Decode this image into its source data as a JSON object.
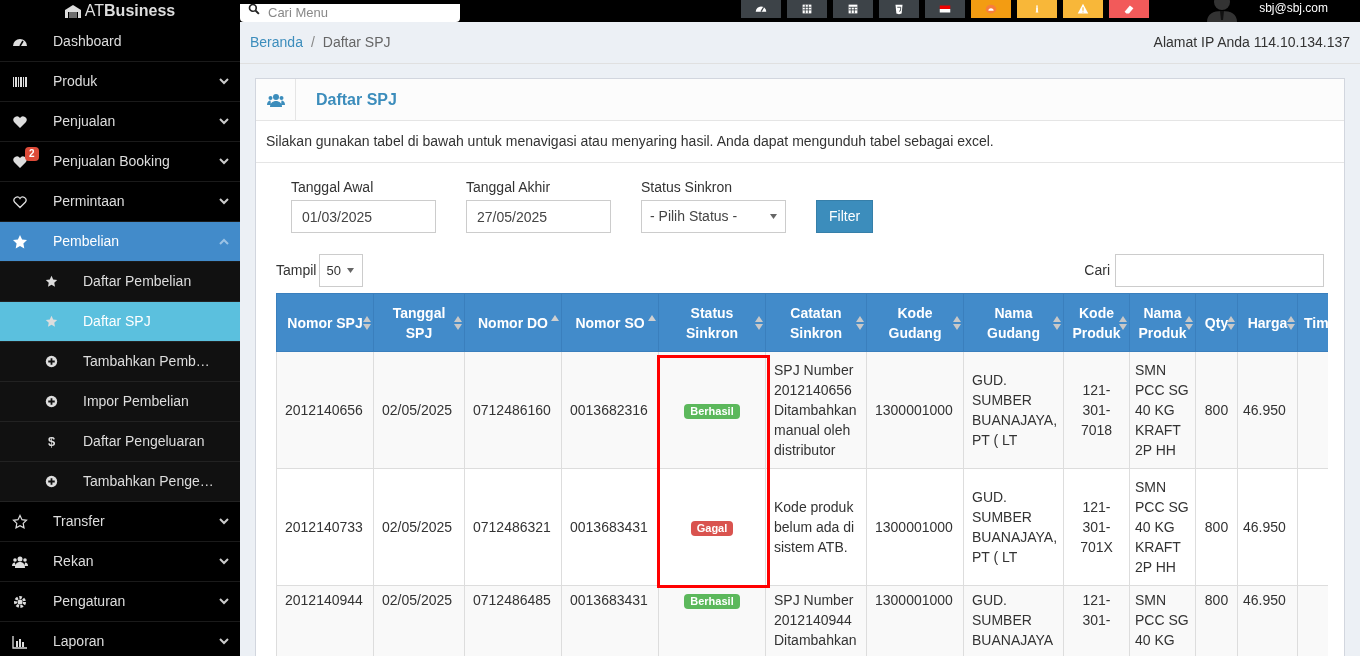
{
  "header": {
    "logo": {
      "light": "AT",
      "bold": "Business"
    },
    "search": {
      "placeholder": "Cari Menu"
    },
    "user_email": "sbj@sbj.com"
  },
  "sidebar": {
    "items": [
      {
        "label": "Dashboard",
        "has_submenu": false,
        "expanded": false,
        "selected": false
      },
      {
        "label": "Produk",
        "has_submenu": true,
        "expanded": false,
        "selected": false
      },
      {
        "label": "Penjualan",
        "has_submenu": true,
        "expanded": false,
        "selected": false
      },
      {
        "label": "Penjualan Booking",
        "badge": "2",
        "has_submenu": true,
        "expanded": false,
        "selected": false
      },
      {
        "label": "Permintaan",
        "has_submenu": true,
        "expanded": false,
        "selected": false
      },
      {
        "label": "Pembelian",
        "has_submenu": true,
        "expanded": true,
        "selected": true,
        "children": [
          {
            "label": "Daftar Pembelian",
            "selected": false
          },
          {
            "label": "Daftar SPJ",
            "selected": true
          },
          {
            "label": "Tambahkan Pemb…",
            "selected": false
          },
          {
            "label": "Impor Pembelian",
            "selected": false
          },
          {
            "label": "Daftar Pengeluaran",
            "icon_char": "$",
            "selected": false
          },
          {
            "label": "Tambahkan Penge…",
            "selected": false
          }
        ]
      },
      {
        "label": "Transfer",
        "has_submenu": true,
        "expanded": false,
        "selected": false
      },
      {
        "label": "Rekan",
        "has_submenu": true,
        "expanded": false,
        "selected": false
      },
      {
        "label": "Pengaturan",
        "has_submenu": true,
        "expanded": false,
        "selected": false
      },
      {
        "label": "Laporan",
        "has_submenu": true,
        "expanded": false,
        "selected": false
      }
    ]
  },
  "breadcrumb": {
    "separator": "/",
    "items": [
      {
        "label": "Beranda",
        "link": true
      },
      {
        "label": "Daftar SPJ",
        "link": false
      }
    ],
    "ip_text": "Alamat IP Anda 114.10.134.137"
  },
  "panel": {
    "title": "Daftar SPJ",
    "description": "Silakan gunakan tabel di bawah untuk menavigasi atau menyaring hasil. Anda dapat mengunduh tabel sebagai excel.",
    "filters": [
      {
        "label": "Tanggal Awal",
        "kind": "input",
        "value": "01/03/2025"
      },
      {
        "label": "Tanggal Akhir",
        "kind": "input",
        "value": "27/05/2025"
      },
      {
        "label": "Status Sinkron",
        "kind": "select",
        "value": "- Pilih Status -"
      }
    ],
    "filter_button": "Filter",
    "page_size_label": "Tampil",
    "page_size": "50",
    "search_label": "Cari"
  },
  "table": {
    "columns": [
      {
        "label": "Nomor SPJ",
        "sortable": true,
        "sorted": false
      },
      {
        "label": "Tanggal SPJ",
        "sortable": true,
        "sorted": false
      },
      {
        "label": "Nomor DO",
        "sortable": true,
        "sorted": true
      },
      {
        "label": "Nomor SO",
        "sortable": true,
        "sorted": true
      },
      {
        "label": "Status Sinkron",
        "sortable": true,
        "sorted": false
      },
      {
        "label": "Catatan Sinkron",
        "sortable": true,
        "sorted": false
      },
      {
        "label": "Kode Gudang",
        "sortable": true,
        "sorted": false
      },
      {
        "label": "Nama Gudang",
        "sortable": true,
        "sorted": false
      },
      {
        "label": "Kode Produk",
        "sortable": true,
        "sorted": false
      },
      {
        "label": "Nama Produk",
        "sortable": true,
        "sorted": false
      },
      {
        "label": "Qty",
        "sortable": true,
        "sorted": false
      },
      {
        "label": "Harga",
        "sortable": true,
        "sorted": false
      },
      {
        "label": "Tim"
      }
    ],
    "rows": [
      {
        "highlighted": true,
        "status": {
          "label": "Berhasil",
          "color": "#5cb85c"
        },
        "cells": [
          "2012140656",
          "02/05/2025",
          "0712486160",
          "0013682316",
          null,
          "SPJ Number 2012140656 Ditambahkan manual oleh distributor",
          "1300001000",
          "GUD. SUMBER BUANAJAYA, PT ( LT",
          "121-301-7018",
          "SMN PCC SG 40 KG KRAFT 2P HH",
          "800",
          "46.950"
        ]
      },
      {
        "highlighted": true,
        "status": {
          "label": "Gagal",
          "color": "#d9534f"
        },
        "cells": [
          "2012140733",
          "02/05/2025",
          "0712486321",
          "0013683431",
          null,
          "Kode produk belum ada di sistem ATB.",
          "1300001000",
          "GUD. SUMBER BUANAJAYA, PT ( LT",
          "121-301-701X",
          "SMN PCC SG 40 KG KRAFT 2P HH",
          "800",
          "46.950"
        ]
      },
      {
        "highlighted": false,
        "status": {
          "label": "Berhasil",
          "color": "#5cb85c"
        },
        "cells": [
          "2012140944",
          "02/05/2025",
          "0712486485",
          "0013683431",
          null,
          "SPJ Number 2012140944 Ditambahkan",
          "1300001000",
          "GUD. SUMBER BUANAJAYA",
          "121-301-",
          "SMN PCC SG 40 KG",
          "800",
          "46.950"
        ]
      }
    ]
  }
}
